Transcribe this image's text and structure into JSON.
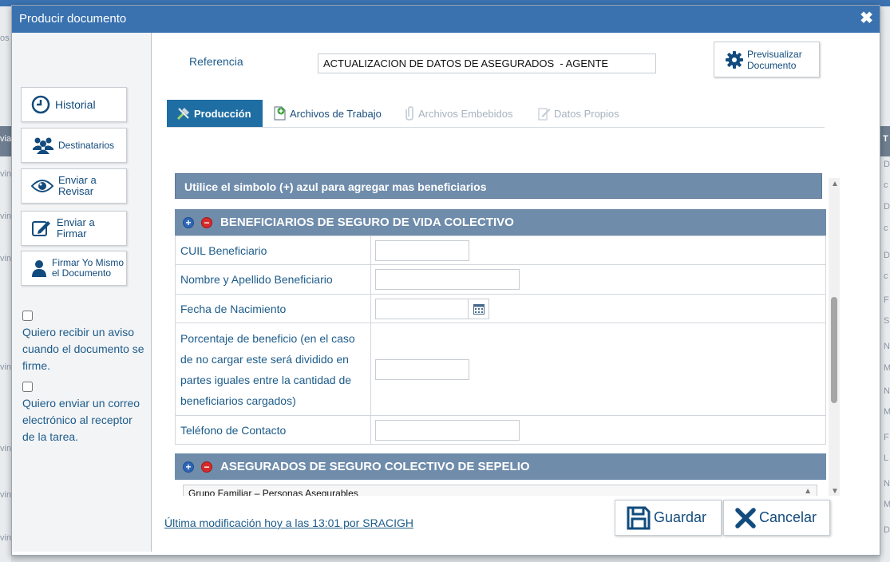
{
  "dialog": {
    "title": "Producir documento"
  },
  "background": {
    "left_fragments": [
      "os",
      "via",
      "vin",
      "vin",
      "vin",
      "vin",
      "vin",
      "vin",
      "vin"
    ],
    "right_fragments": [
      "T",
      "D",
      "c",
      "D",
      "c",
      "D",
      "c",
      "F",
      "S",
      "N",
      "M",
      "N",
      "M",
      "F",
      "L",
      "N",
      "M",
      "D"
    ]
  },
  "sidebar": {
    "buttons": [
      {
        "label": "Historial",
        "icon": "clock-icon"
      },
      {
        "label": "Destinatarios",
        "icon": "users-icon"
      },
      {
        "label_line1": "Enviar a",
        "label_line2": "Revisar",
        "icon": "eye-icon"
      },
      {
        "label_line1": "Enviar a",
        "label_line2": "Firmar",
        "icon": "pen-icon"
      },
      {
        "label_line1": "Firmar Yo Mismo",
        "label_line2": "el Documento",
        "icon": "user-icon"
      }
    ],
    "checkboxes": [
      {
        "checked": false,
        "text": "Quiero recibir un aviso cuando el documento se firme."
      },
      {
        "checked": false,
        "text": "Quiero enviar un correo electrónico al receptor de la tarea."
      }
    ]
  },
  "reference": {
    "label": "Referencia",
    "value": "ACTUALIZACION DE DATOS DE ASEGURADOS  - AGENTE"
  },
  "preview_button": {
    "line1": "Previsualizar",
    "line2": "Documento"
  },
  "tabs": [
    {
      "label": "Producción",
      "state": "active"
    },
    {
      "label": "Archivos de Trabajo",
      "state": "normal"
    },
    {
      "label": "Archivos Embebidos",
      "state": "disabled"
    },
    {
      "label": "Datos Propios",
      "state": "disabled"
    }
  ],
  "form": {
    "info_text": "Utilice el simbolo (+) azul para agregar mas beneficiarios",
    "section1": {
      "title": "BENEFICIARIOS DE SEGURO DE VIDA COLECTIVO",
      "fields": [
        {
          "label": "CUIL Beneficiario",
          "value": ""
        },
        {
          "label": "Nombre y Apellido Beneficiario",
          "value": ""
        },
        {
          "label": "Fecha de Nacimiento",
          "value": ""
        },
        {
          "label": "Porcentaje de beneficio (en el caso de no cargar este será dividido en partes iguales entre la cantidad de beneficiarios cargados)",
          "value": ""
        },
        {
          "label": "Teléfono de Contacto",
          "value": ""
        }
      ]
    },
    "section2": {
      "title": "ASEGURADOS DE SEGURO COLECTIVO DE SEPELIO",
      "select_value": "Grupo Familiar – Personas Asegurables"
    }
  },
  "footer": {
    "last_modified": "Última modificación hoy a las 13:01 por SRACIGH",
    "save_label": "Guardar",
    "cancel_label": "Cancelar"
  },
  "colors": {
    "titlebar": "#3a72b0",
    "section_header": "#6f8cab",
    "active_tab": "#1f6ea3",
    "text_blue": "#1d5c8a",
    "remove_red": "#d52b2b"
  }
}
